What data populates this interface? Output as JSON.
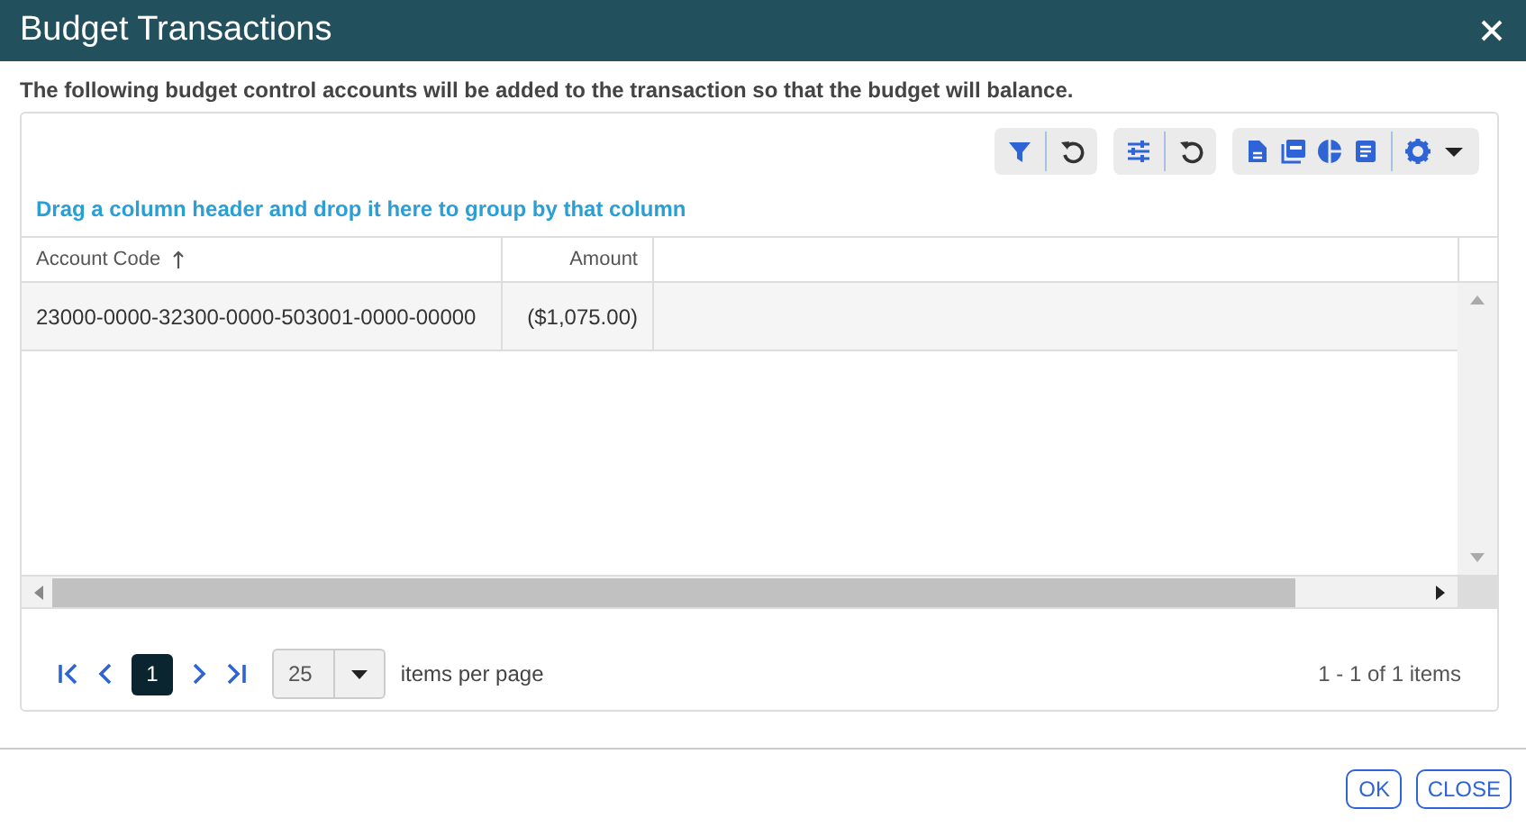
{
  "window": {
    "title": "Budget Transactions"
  },
  "message": "The following budget control accounts will be added to the transaction so that the budget will balance.",
  "grid": {
    "group_hint": "Drag a column header and drop it here to group by that column",
    "columns": [
      {
        "label": "Account Code",
        "sorted": true
      },
      {
        "label": "Amount",
        "sorted": false
      }
    ],
    "rows": [
      {
        "cells": [
          "23000-0000-32300-0000-503001-0000-00000",
          "($1,075.00)"
        ]
      }
    ],
    "pager": {
      "pages": [
        {
          "label": "1",
          "selected": true
        }
      ],
      "page_size": "25",
      "page_size_label": "items per page",
      "summary": "1 - 1 of 1 items"
    }
  },
  "buttons": [
    "OK",
    "CLOSE"
  ]
}
